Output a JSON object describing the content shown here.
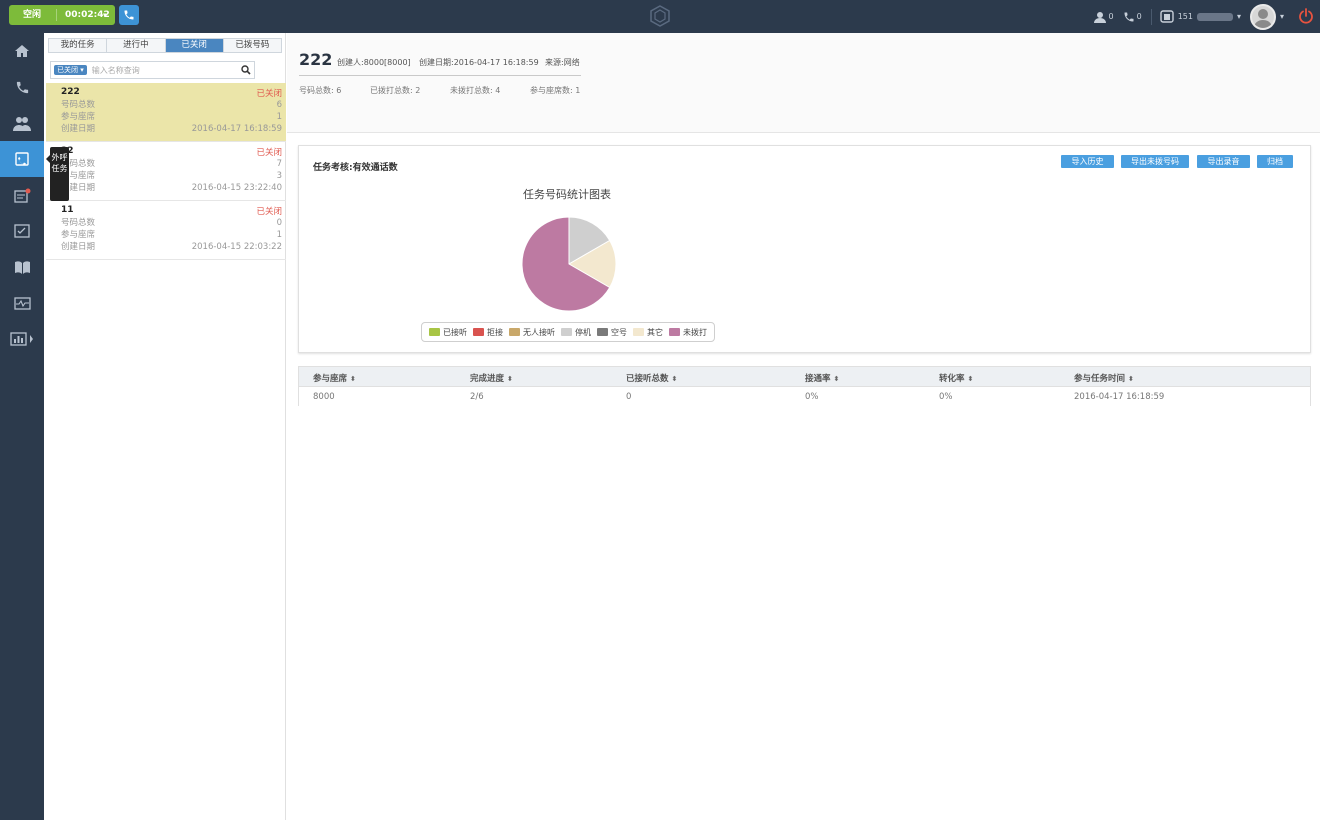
{
  "topbar": {
    "status_label": "空闲",
    "timer": "00:02:42",
    "agents_count": "0",
    "calls_count": "0",
    "extension": "151"
  },
  "nav": {
    "tooltip": "外呼任务",
    "items": [
      "home-icon",
      "phone-icon",
      "contacts-icon",
      "outbound-task-icon",
      "ticket-icon",
      "checklist-icon",
      "knowledge-icon",
      "monitor-icon",
      "report-icon"
    ]
  },
  "task_panel": {
    "tabs": [
      "我的任务",
      "进行中",
      "已关闭",
      "已拨号码"
    ],
    "active_tab": "已关闭",
    "filter": "已关闭",
    "search_placeholder": "输入名称查询",
    "tasks": [
      {
        "name": "222",
        "status": "已关闭",
        "total_label": "号码总数",
        "total": "6",
        "seats_label": "参与座席",
        "seats": "1",
        "date_label": "创建日期",
        "date": "2016-04-17 16:18:59"
      },
      {
        "name": "22",
        "status": "已关闭",
        "total_label": "号码总数",
        "total": "7",
        "seats_label": "参与座席",
        "seats": "3",
        "date_label": "创建日期",
        "date": "2016-04-15 23:22:40"
      },
      {
        "name": "11",
        "status": "已关闭",
        "total_label": "号码总数",
        "total": "0",
        "seats_label": "参与座席",
        "seats": "1",
        "date_label": "创建日期",
        "date": "2016-04-15 22:03:22"
      }
    ]
  },
  "detail": {
    "title": "222",
    "creator": "创建人:8000[8000]",
    "created": "创建日期:2016-04-17 16:18:59",
    "source": "来源:网络",
    "stats": [
      "号码总数: 6",
      "已拨打总数: 2",
      "未拨打总数: 4",
      "参与座席数: 1"
    ]
  },
  "card": {
    "title": "任务考核:有效通话数",
    "buttons": [
      "导入历史",
      "导出未拨号码",
      "导出录音",
      "归档"
    ]
  },
  "chart_data": {
    "type": "pie",
    "title": "任务号码统计图表",
    "legend_position": "bottom",
    "slices": [
      {
        "name": "已接听",
        "value": 0,
        "color": "#a8c545"
      },
      {
        "name": "拒接",
        "value": 0,
        "color": "#d9534f"
      },
      {
        "name": "无人接听",
        "value": 0,
        "color": "#c9a86a"
      },
      {
        "name": "停机",
        "value": 1,
        "color": "#cfcfcf"
      },
      {
        "name": "空号",
        "value": 0,
        "color": "#7a7a7a"
      },
      {
        "name": "其它",
        "value": 1,
        "color": "#f3e8cf"
      },
      {
        "name": "未拨打",
        "value": 4,
        "color": "#bd7aa2"
      }
    ]
  },
  "table": {
    "columns": [
      "参与座席",
      "完成进度",
      "已接听总数",
      "接通率",
      "转化率",
      "参与任务时间"
    ],
    "rows": [
      [
        "8000",
        "2/6",
        "0",
        "0%",
        "0%",
        "2016-04-17 16:18:59"
      ]
    ]
  }
}
